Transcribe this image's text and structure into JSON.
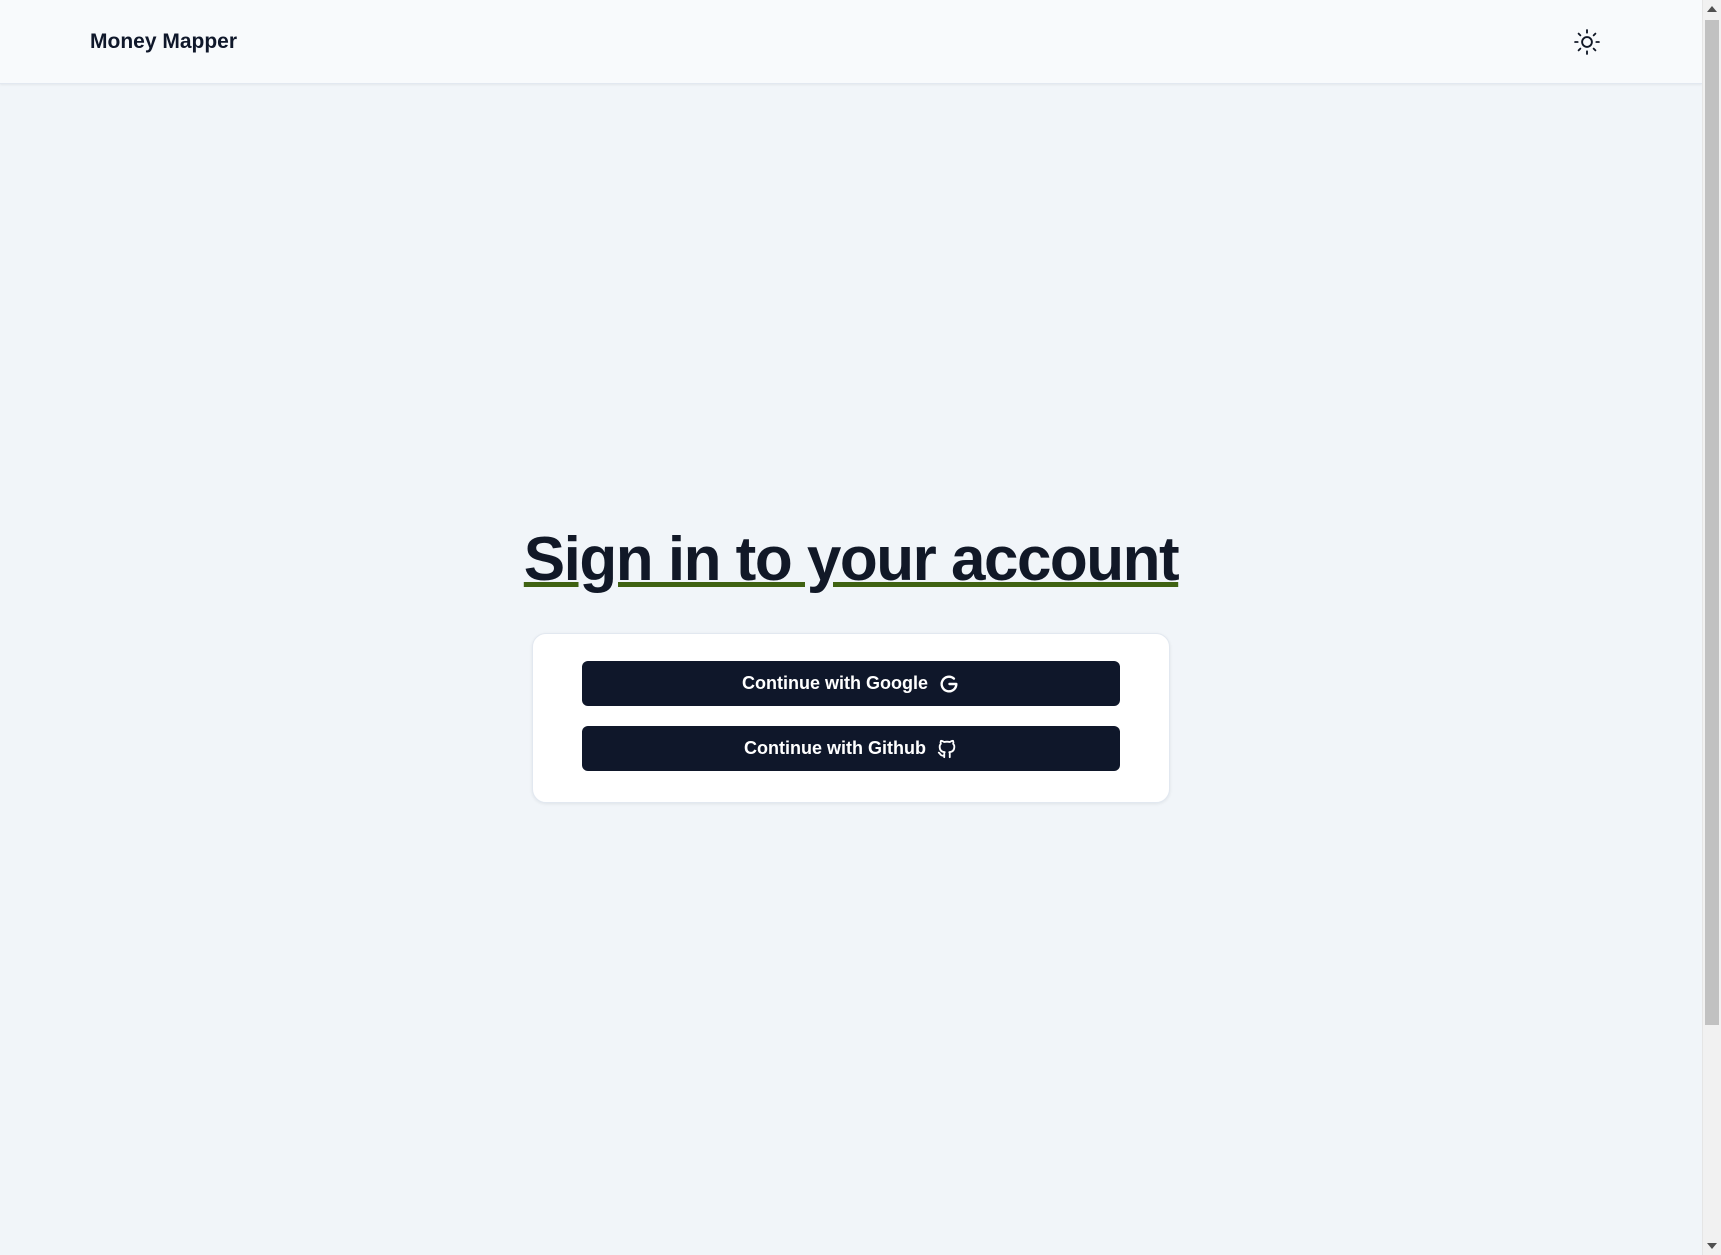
{
  "header": {
    "brand": "Money Mapper",
    "theme_toggle_icon": "sun-icon"
  },
  "main": {
    "title": "Sign in to your account",
    "buttons": {
      "google_label": "Continue with Google",
      "google_icon": "google-icon",
      "github_label": "Continue with Github",
      "github_icon": "github-icon"
    }
  },
  "colors": {
    "background": "#f1f5f9",
    "header_background": "#f8fafc",
    "button_background": "#0f172a",
    "title_underline": "#3f6212"
  }
}
